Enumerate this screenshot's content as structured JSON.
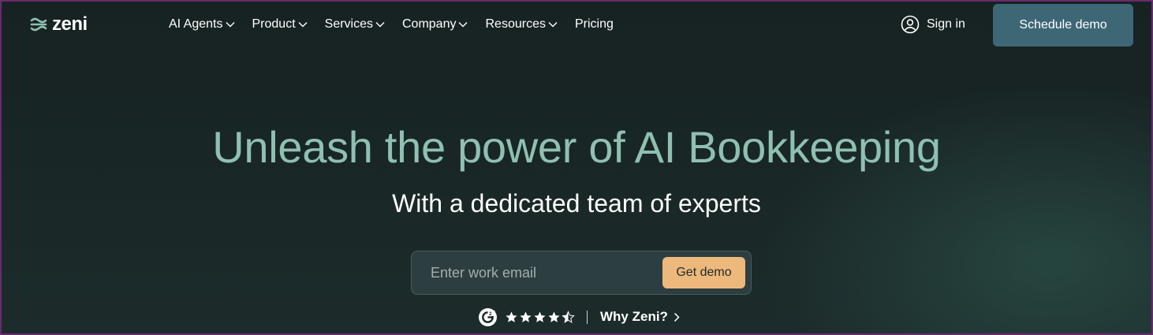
{
  "brand": {
    "name": "zeni"
  },
  "nav": {
    "items": [
      {
        "label": "AI Agents",
        "dropdown": true
      },
      {
        "label": "Product",
        "dropdown": true
      },
      {
        "label": "Services",
        "dropdown": true
      },
      {
        "label": "Company",
        "dropdown": true
      },
      {
        "label": "Resources",
        "dropdown": true
      },
      {
        "label": "Pricing",
        "dropdown": false
      }
    ],
    "signin_label": "Sign in",
    "schedule_label": "Schedule demo"
  },
  "hero": {
    "title": "Unleash the power of AI Bookkeeping",
    "subtitle": "With a dedicated team of experts",
    "email_placeholder": "Enter work email",
    "email_value": "",
    "cta_label": "Get demo"
  },
  "rating": {
    "provider_icon": "g2-logo-icon",
    "stars": 4.5,
    "max_stars": 5,
    "why_label": "Why Zeni?"
  },
  "colors": {
    "background": "#1a2627",
    "title": "#8fc0b2",
    "schedule_button": "#3e6776",
    "cta_button": "#edb87b",
    "frame_border": "#6b2a6e"
  }
}
